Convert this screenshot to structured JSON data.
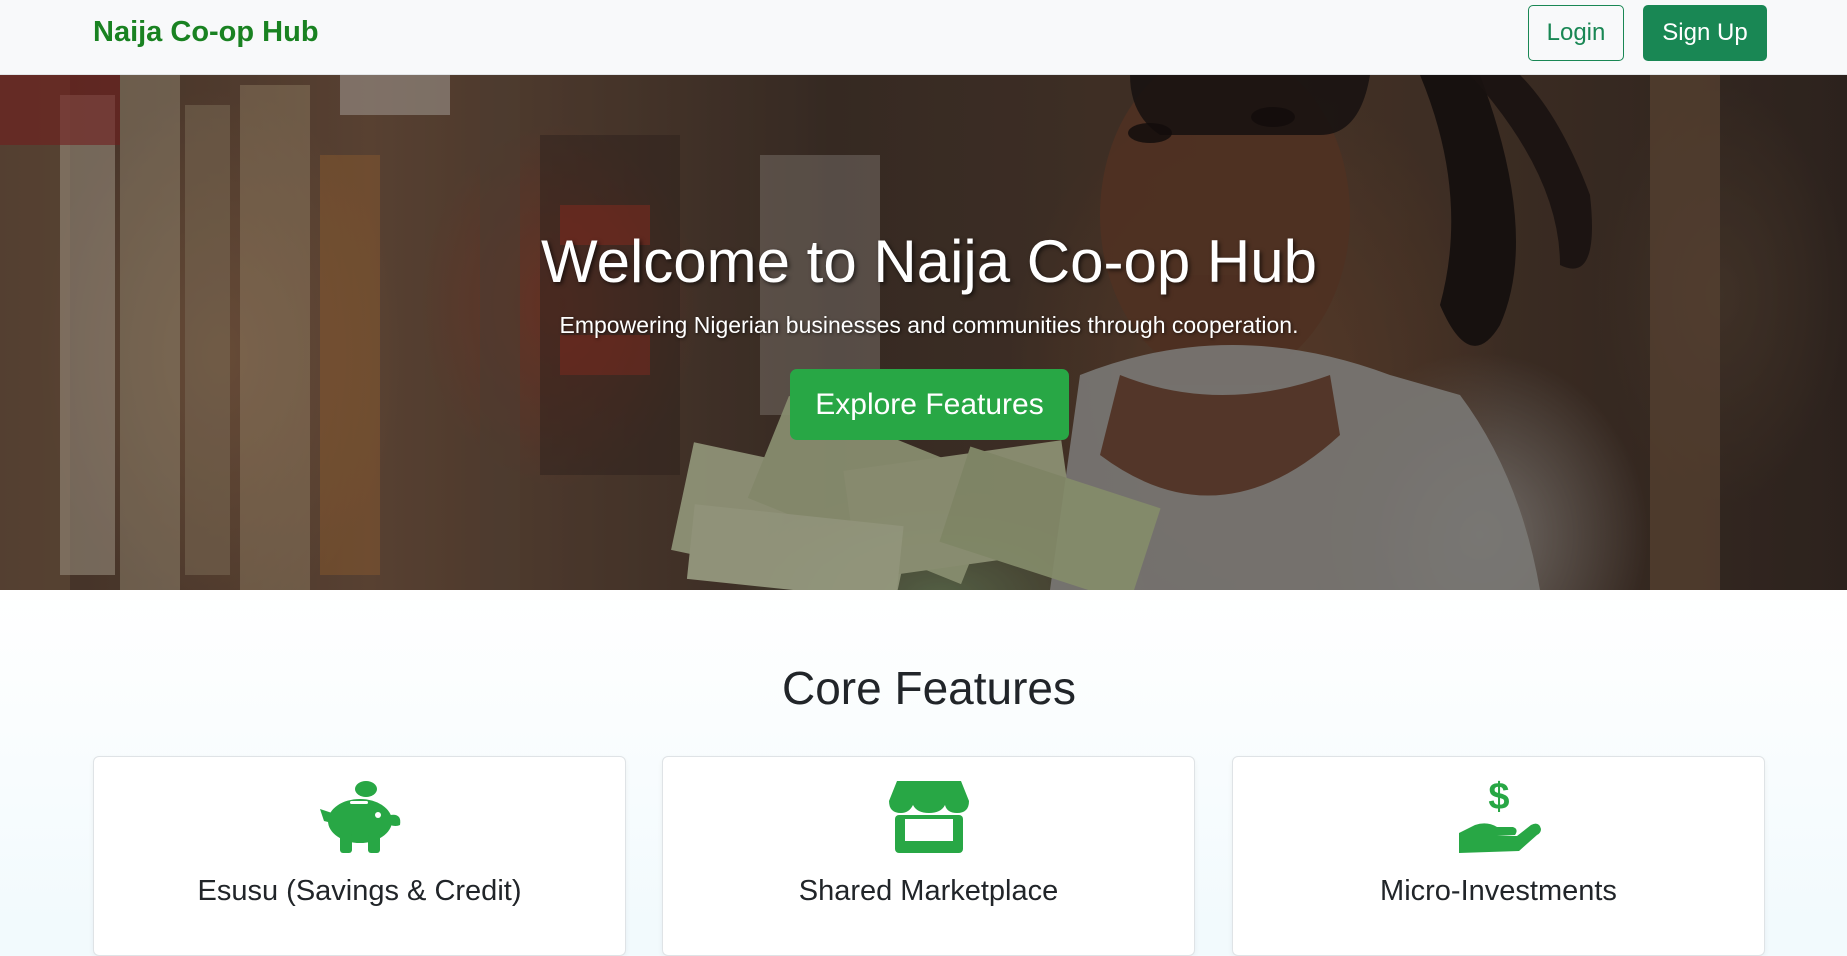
{
  "nav": {
    "brand": "Naija Co-op Hub",
    "login_label": "Login",
    "signup_label": "Sign Up"
  },
  "hero": {
    "title": "Welcome to Naija Co-op Hub",
    "subtitle": "Empowering Nigerian businesses and communities through cooperation.",
    "cta_label": "Explore Features"
  },
  "features": {
    "heading": "Core Features",
    "cards": [
      {
        "icon": "piggy-bank-icon",
        "title": "Esusu (Savings & Credit)"
      },
      {
        "icon": "shop-icon",
        "title": "Shared Marketplace"
      },
      {
        "icon": "hand-holding-dollar-icon",
        "title": "Micro-Investments"
      }
    ]
  },
  "colors": {
    "brand_green": "#198754",
    "accent_green": "#28a745",
    "icon_green": "#28a745"
  }
}
